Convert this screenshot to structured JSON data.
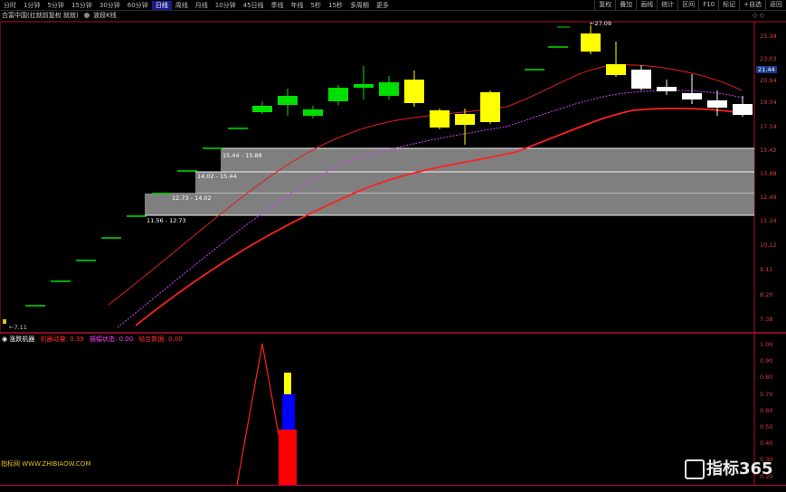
{
  "periods": [
    "分时",
    "1分钟",
    "5分钟",
    "15分钟",
    "30分钟",
    "60分钟",
    "日线",
    "周线",
    "月线",
    "10分钟",
    "45日线",
    "季线",
    "年线",
    "5秒",
    "15秒",
    "多周期",
    "更多"
  ],
  "active_period": "日线",
  "tools": [
    "复权",
    "叠加",
    "画线",
    "统计",
    "区间",
    "F10",
    "标记",
    "+自选",
    "返回"
  ],
  "title": {
    "main": "合富中国(扛就前复权 就就)",
    "indicator": "波段K线"
  },
  "price_axis": [
    "25.34",
    "23.03",
    "20.94",
    "19.04",
    "17.14",
    "15.42",
    "13.88",
    "12.49",
    "11.24",
    "10.12",
    "9.11",
    "8.20",
    "7.38"
  ],
  "current_price": "21.44",
  "peak_label": "27.09",
  "low_label": "7.11",
  "bands": [
    {
      "text": "15.44 - 15.88"
    },
    {
      "text": "14.02 - 15.44"
    },
    {
      "text": "12.73 - 14.02"
    },
    {
      "text": "11.56 - 12.73"
    }
  ],
  "sub_indicator": {
    "name": "涨跌机器",
    "items": [
      {
        "label": "机器动量: 0.39",
        "color": "#ff3030"
      },
      {
        "label": "振幅状态: 0.00",
        "color": "#ff40ff"
      },
      {
        "label": "结合数据: 0.00",
        "color": "#ff3030"
      }
    ],
    "axis": [
      "1.00",
      "0.90",
      "0.80",
      "0.70",
      "0.60",
      "0.50",
      "0.40",
      "0.30",
      "0.20"
    ]
  },
  "watermark": "指标网 WWW.ZHIBIAOW.COM",
  "logo_text": "指标365",
  "colors": {
    "up": "#ffff00",
    "down": "#ffffff",
    "green": "#00e000",
    "band": "#7f7f7f",
    "red": "#e02020"
  }
}
